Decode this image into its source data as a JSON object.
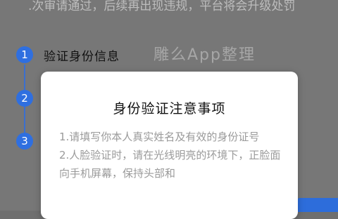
{
  "background": {
    "notice_text": ".次审请通过，后续再出现违规，平台将会升级处罚",
    "watermark": "雕么App整理",
    "steps": [
      {
        "number": "1",
        "label": "验证身份信息"
      },
      {
        "number": "2"
      },
      {
        "number": "3"
      }
    ]
  },
  "modal": {
    "title": "身份验证注意事项",
    "items": [
      "1.请填写你本人真实姓名及有效的身份证号",
      "2.人脸验证时，请在光线明亮的环境下，正脸面向手机屏幕，保持头部和"
    ]
  },
  "colors": {
    "accent": "#2f6fe0",
    "overlay": "#777777",
    "modal_bg": "#ffffff",
    "body_text": "#9a9a9a"
  }
}
